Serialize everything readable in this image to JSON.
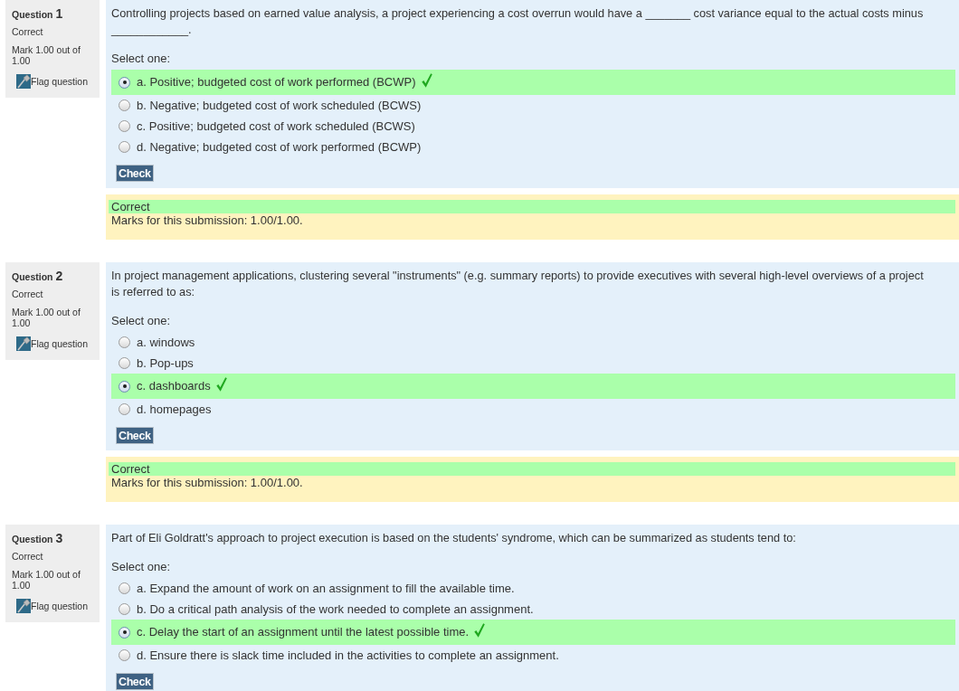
{
  "questions": [
    {
      "label": "Question",
      "number": "1",
      "state": "Correct",
      "mark": "Mark 1.00 out of 1.00",
      "flag": "Flag question",
      "text": "Controlling projects based on earned value analysis, a project experiencing a cost overrun would have a _______ cost variance equal to the actual costs minus ____________.",
      "prompt": "Select one:",
      "answers": [
        {
          "label": "a. Positive; budgeted cost of work performed (BCWP)",
          "selected": true,
          "correct": true
        },
        {
          "label": "b. Negative; budgeted cost of work scheduled (BCWS)",
          "selected": false,
          "correct": false
        },
        {
          "label": "c. Positive; budgeted cost of work scheduled (BCWS)",
          "selected": false,
          "correct": false
        },
        {
          "label": "d. Negative; budgeted cost of work performed (BCWP)",
          "selected": false,
          "correct": false
        }
      ],
      "check_button": "Check",
      "feedback": {
        "status": "Correct",
        "marks": "Marks for this submission: 1.00/1.00."
      }
    },
    {
      "label": "Question",
      "number": "2",
      "state": "Correct",
      "mark": "Mark 1.00 out of 1.00",
      "flag": "Flag question",
      "text": "In project management applications, clustering several \"instruments\" (e.g. summary reports) to provide executives with several high-level overviews of a project is referred to as:",
      "prompt": "Select one:",
      "answers": [
        {
          "label": "a. windows",
          "selected": false,
          "correct": false
        },
        {
          "label": "b. Pop-ups",
          "selected": false,
          "correct": false
        },
        {
          "label": "c. dashboards",
          "selected": true,
          "correct": true
        },
        {
          "label": "d. homepages",
          "selected": false,
          "correct": false
        }
      ],
      "check_button": "Check",
      "feedback": {
        "status": "Correct",
        "marks": "Marks for this submission: 1.00/1.00."
      }
    },
    {
      "label": "Question",
      "number": "3",
      "state": "Correct",
      "mark": "Mark 1.00 out of 1.00",
      "flag": "Flag question",
      "text": "Part of Eli Goldratt's approach to project execution is based on the students' syndrome, which can be summarized as students tend to:",
      "prompt": "Select one:",
      "answers": [
        {
          "label": "a. Expand the amount of work on an assignment to fill the available time.",
          "selected": false,
          "correct": false
        },
        {
          "label": "b. Do a critical path analysis of the work needed to complete an assignment.",
          "selected": false,
          "correct": false
        },
        {
          "label": "c. Delay the start of an assignment until the latest possible time.",
          "selected": true,
          "correct": true
        },
        {
          "label": "d. Ensure there is slack time included in the activities to complete an assignment.",
          "selected": false,
          "correct": false
        }
      ],
      "check_button": "Check"
    }
  ]
}
